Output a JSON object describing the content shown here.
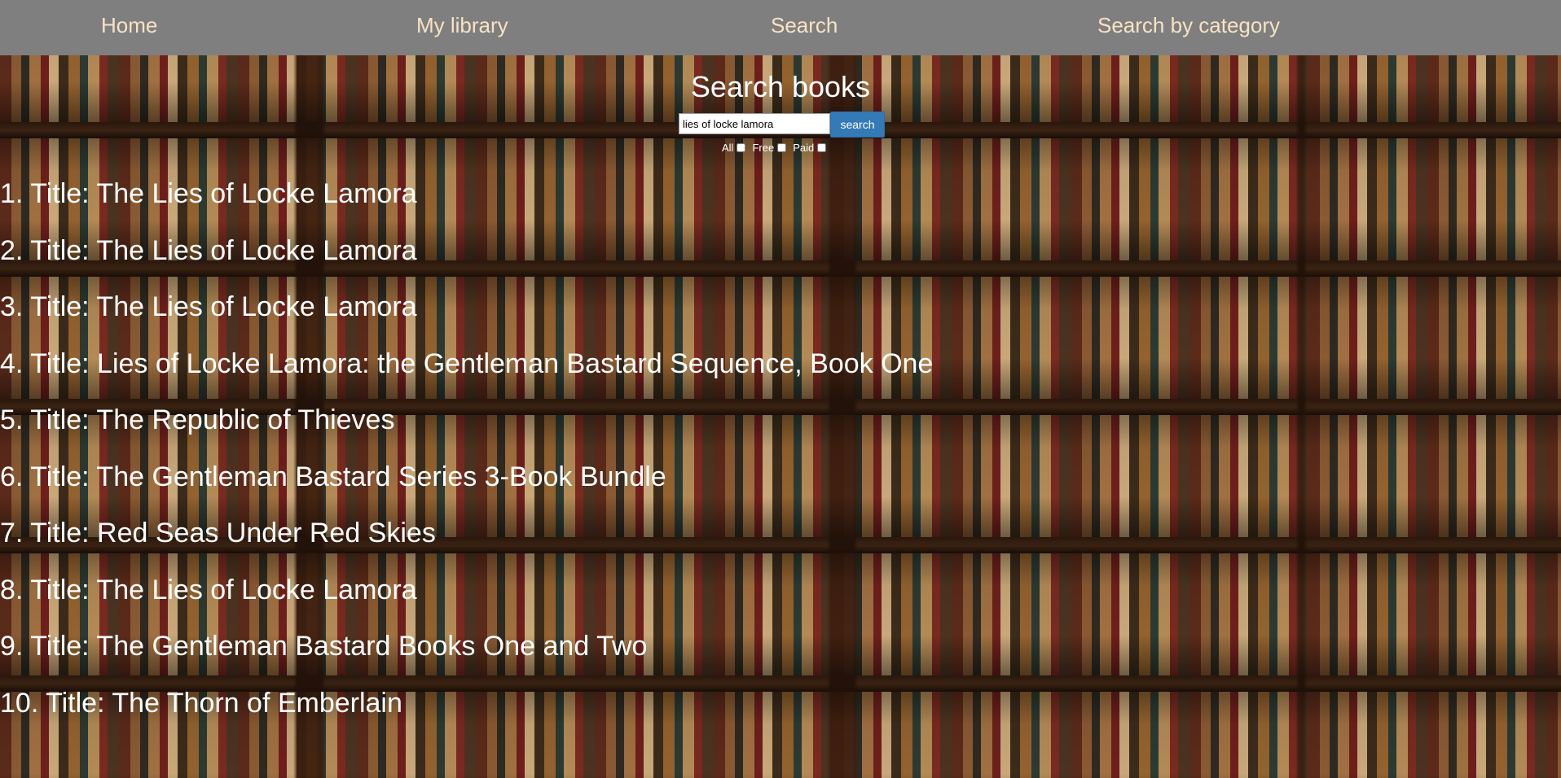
{
  "nav": {
    "items": [
      "Home",
      "My library",
      "Search",
      "Search by category"
    ]
  },
  "search": {
    "heading": "Search books",
    "query": "lies of locke lamora",
    "button_label": "search",
    "filters": [
      "All",
      "Free",
      "Paid"
    ]
  },
  "results": [
    "1. Title: The Lies of Locke Lamora",
    "2. Title: The Lies of Locke Lamora",
    "3. Title: The Lies of Locke Lamora",
    "4. Title: Lies of Locke Lamora: the Gentleman Bastard Sequence, Book One",
    "5. Title: The Republic of Thieves",
    "6. Title: The Gentleman Bastard Series 3-Book Bundle",
    "7. Title: Red Seas Under Red Skies",
    "8. Title: The Lies of Locke Lamora",
    "9. Title: The Gentleman Bastard Books One and Two",
    "10. Title: The Thorn of Emberlain"
  ],
  "colors": {
    "navbar_bg": "#7f7f7f",
    "nav_text": "#f7e3c4",
    "button_bg": "#337ab7"
  }
}
